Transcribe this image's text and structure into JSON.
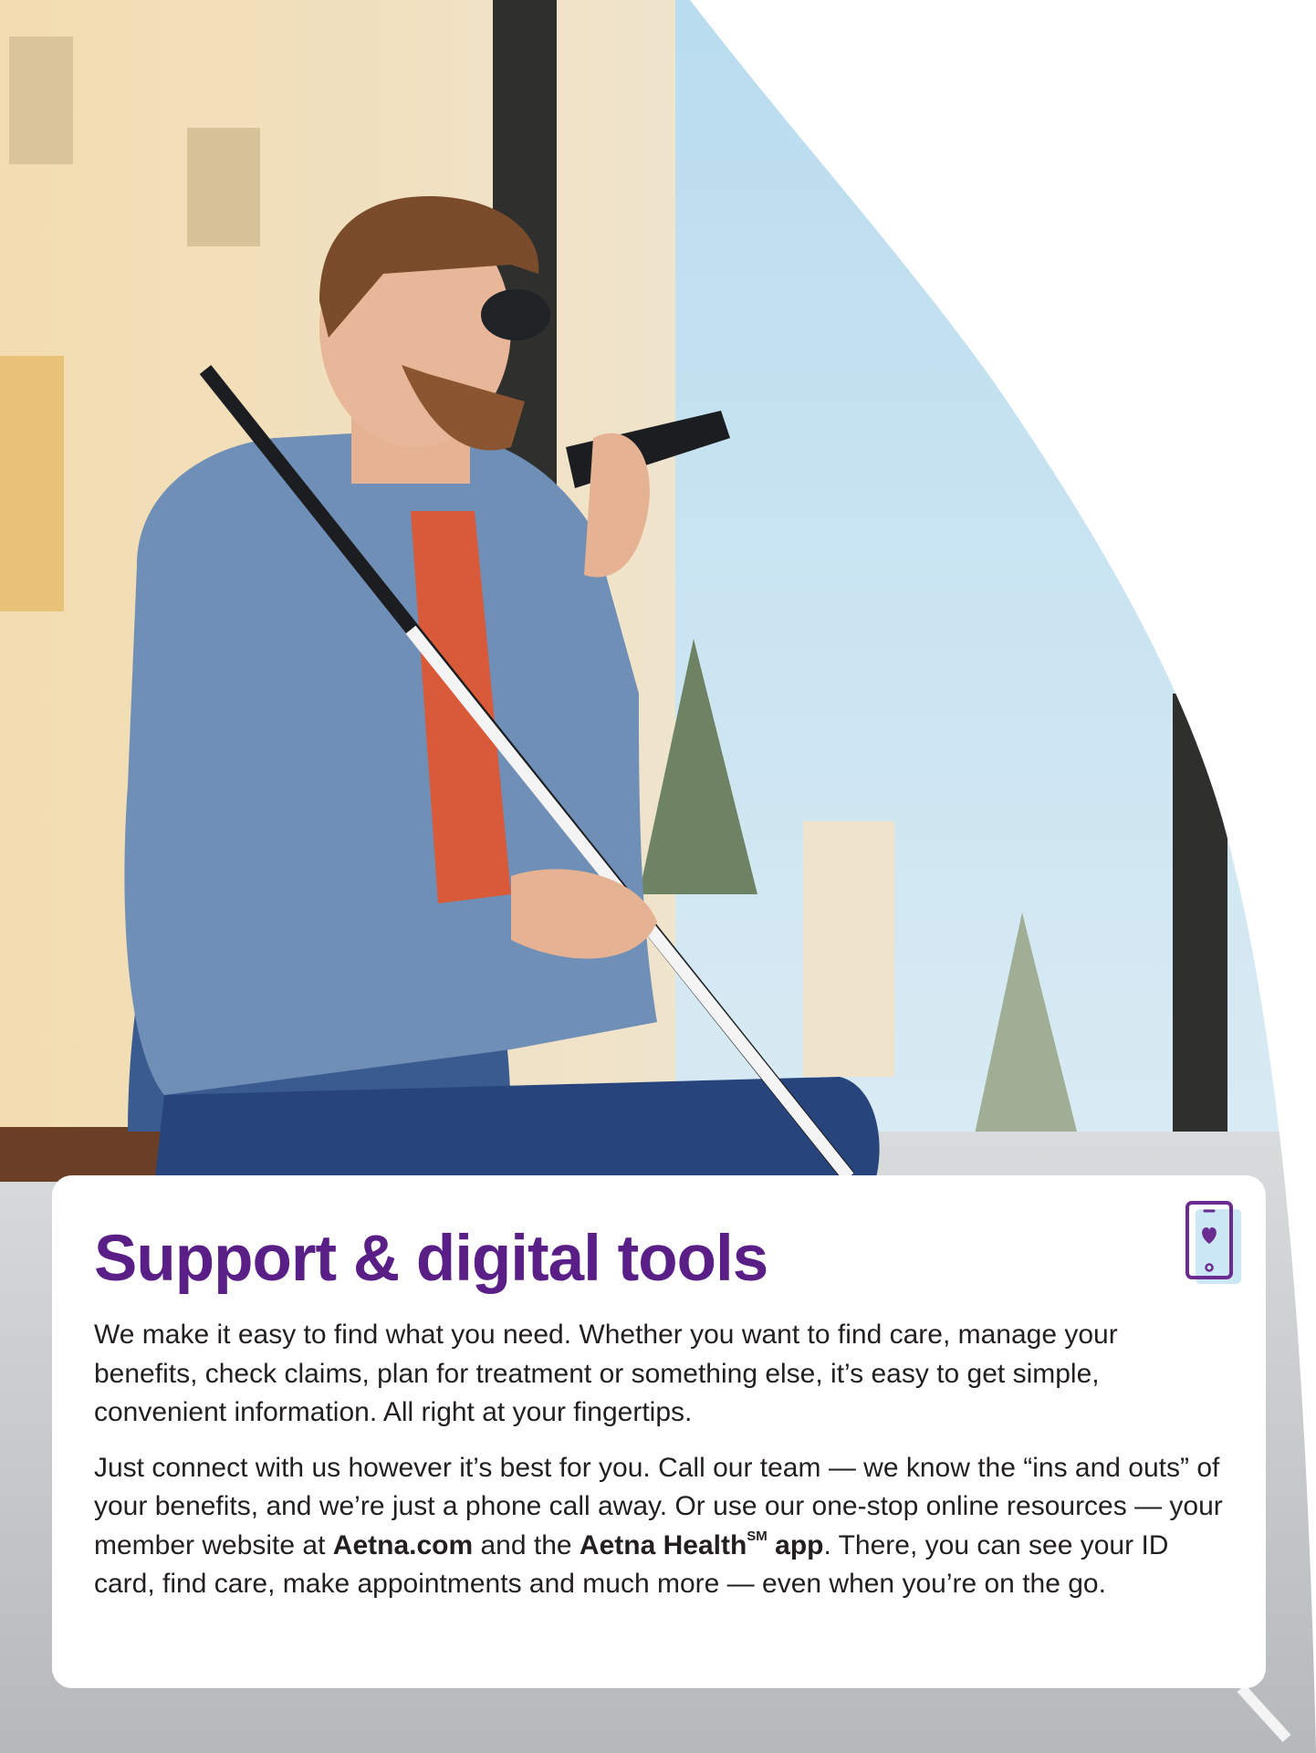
{
  "heading": "Support & digital tools",
  "paragraph_1": "We make it easy to find what you need. Whether you want to find care, manage your benefits, check claims, plan for treatment or something else, it’s easy to get simple, convenient information. All right at your fingertips.",
  "paragraph_2": {
    "part_1": "Just connect with us however it’s best for you. Call our team — we know the “ins and outs” of your benefits, and we’re just a phone call away. Or use our one-stop online resources — your member website at ",
    "website": "Aetna.com",
    "part_2": " and the ",
    "app_name": "Aetna Health",
    "service_mark": "SM",
    "app_word": " app",
    "part_3": ". There, you can see your ID card, find care, make appointments and much more — even when you’re on the go."
  },
  "icons": {
    "card_icon": "phone-heart-icon"
  },
  "colors": {
    "heading": "#5a1f86",
    "body_text": "#231f20",
    "icon_outline": "#6b2c91",
    "icon_fill": "#cce8f7"
  }
}
